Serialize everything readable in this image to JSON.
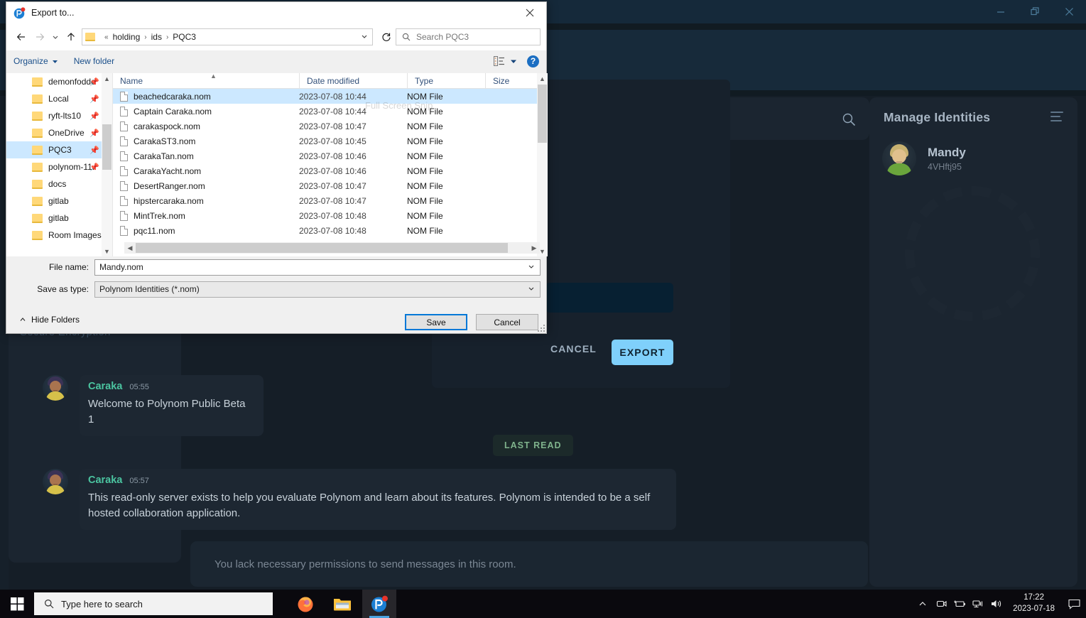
{
  "app": {
    "titlebar": {
      "minimize_label": "minimize",
      "restore_label": "restore",
      "close_label": "close"
    },
    "left_panel": {
      "heading": "Secure Encryption"
    },
    "center": {
      "search_icon": "search-icon",
      "messages": [
        {
          "author": "Caraka",
          "time": "05:55",
          "text": "Welcome to Polynom Public Beta 1"
        },
        {
          "author": "Caraka",
          "time": "05:57",
          "text": "This read-only server exists to help you evaluate Polynom and learn about its features. Polynom is intended to be a self hosted collaboration application."
        }
      ],
      "last_read_label": "LAST READ",
      "composer_disabled_text": "You lack necessary permissions to send messages in this room."
    },
    "right_panel": {
      "title": "Manage Identities",
      "menu_icon": "hamburger-menu-icon",
      "identity": {
        "name": "Mandy",
        "id": "4VHftj95"
      }
    },
    "export_modal": {
      "close_icon": "close-icon",
      "cancel_label": "CANCEL",
      "export_label": "EXPORT"
    },
    "colors": {
      "accent": "#7fd0fb",
      "author": "#4bc4a0",
      "panel": "#1b2530",
      "background": "#151e27"
    }
  },
  "dialog": {
    "title": "Export to...",
    "app_icon": "polynom-logo-icon",
    "close_icon": "close-icon",
    "nav": {
      "back_icon": "arrow-left-icon",
      "forward_icon": "arrow-right-icon",
      "recent_icon": "chevron-down-icon",
      "up_icon": "arrow-up-icon",
      "refresh_icon": "refresh-icon",
      "breadcrumb_prefix": "«",
      "breadcrumb": [
        "holding",
        "ids",
        "PQC3"
      ],
      "search_placeholder": "Search PQC3",
      "search_icon": "search-icon"
    },
    "toolbar": {
      "organize_label": "Organize",
      "new_folder_label": "New folder",
      "view_icon": "list-view-icon",
      "view_chevron_icon": "chevron-down-icon",
      "help_label": "?"
    },
    "tree": {
      "items": [
        {
          "label": "demonfodde",
          "pinned": true,
          "selected": false,
          "partial": true
        },
        {
          "label": "Local",
          "pinned": true,
          "selected": false
        },
        {
          "label": "ryft-lts10",
          "pinned": true,
          "selected": false
        },
        {
          "label": "OneDrive",
          "pinned": true,
          "selected": false
        },
        {
          "label": "PQC3",
          "pinned": true,
          "selected": true
        },
        {
          "label": "polynom-11.",
          "pinned": true,
          "selected": false
        },
        {
          "label": "docs",
          "pinned": false,
          "selected": false
        },
        {
          "label": "gitlab",
          "pinned": false,
          "selected": false
        },
        {
          "label": "gitlab",
          "pinned": false,
          "selected": false
        },
        {
          "label": "Room Images",
          "pinned": false,
          "selected": false
        }
      ]
    },
    "filelist": {
      "columns": [
        "Name",
        "Date modified",
        "Type",
        "Size"
      ],
      "sort_indicator": "ascending",
      "rows": [
        {
          "name": "beachedcaraka.nom",
          "date": "2023-07-08 10:44",
          "type": "NOM File",
          "size": "",
          "selected": true
        },
        {
          "name": "Captain Caraka.nom",
          "date": "2023-07-08 10:44",
          "type": "NOM File",
          "size": "",
          "selected": false
        },
        {
          "name": "carakaspock.nom",
          "date": "2023-07-08 10:47",
          "type": "NOM File",
          "size": "",
          "selected": false
        },
        {
          "name": "CarakaST3.nom",
          "date": "2023-07-08 10:45",
          "type": "NOM File",
          "size": "",
          "selected": false
        },
        {
          "name": "CarakaTan.nom",
          "date": "2023-07-08 10:46",
          "type": "NOM File",
          "size": "",
          "selected": false
        },
        {
          "name": "CarakaYacht.nom",
          "date": "2023-07-08 10:46",
          "type": "NOM File",
          "size": "",
          "selected": false
        },
        {
          "name": "DesertRanger.nom",
          "date": "2023-07-08 10:47",
          "type": "NOM File",
          "size": "",
          "selected": false
        },
        {
          "name": "hipstercaraka.nom",
          "date": "2023-07-08 10:47",
          "type": "NOM File",
          "size": "",
          "selected": false
        },
        {
          "name": "MintTrek.nom",
          "date": "2023-07-08 10:48",
          "type": "NOM File",
          "size": "",
          "selected": false
        },
        {
          "name": "pqc11.nom",
          "date": "2023-07-08 10:48",
          "type": "NOM File",
          "size": "",
          "selected": false
        }
      ],
      "watermark": "Full Screen Snip"
    },
    "fields": {
      "filename_label": "File name:",
      "filename_value": "Mandy.nom",
      "savetype_label": "Save as type:",
      "savetype_value": "Polynom Identities (*.nom)"
    },
    "footer": {
      "hide_folders_label": "Hide Folders",
      "save_label": "Save",
      "cancel_label": "Cancel"
    }
  },
  "taskbar": {
    "start_icon": "windows-logo-icon",
    "search_placeholder": "Type here to search",
    "search_icon": "search-icon",
    "apps": [
      {
        "name": "firefox-icon",
        "active": false
      },
      {
        "name": "file-explorer-icon",
        "active": false
      },
      {
        "name": "polynom-icon",
        "active": true
      }
    ],
    "tray": {
      "chevron_icon": "chevron-up-icon",
      "camera_icon": "camera-icon",
      "battery_icon": "battery-icon",
      "network_icon": "network-icon",
      "volume_icon": "volume-icon",
      "time": "17:22",
      "date": "2023-07-18",
      "notification_icon": "notification-icon"
    }
  }
}
